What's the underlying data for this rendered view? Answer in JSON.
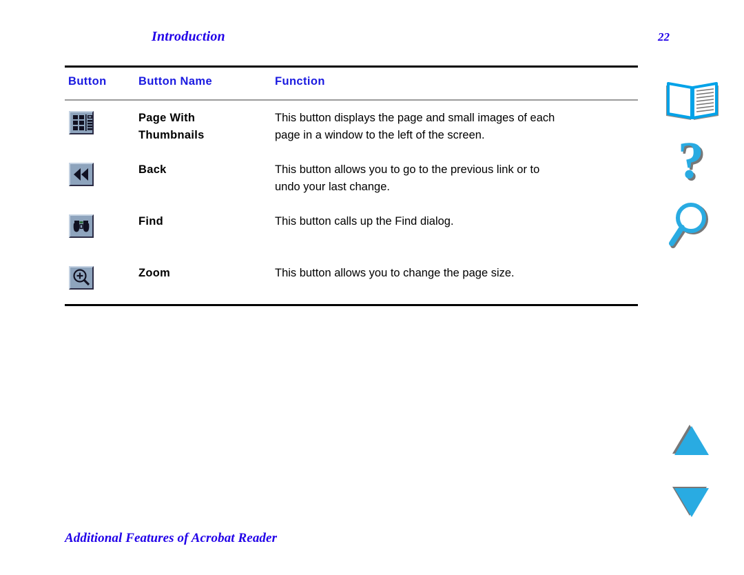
{
  "document": {
    "header_title": "Introduction",
    "page_number": "22",
    "footer_link": "Additional Features of Acrobat Reader"
  },
  "table": {
    "columns": {
      "button": "Button",
      "button_name": "Button Name",
      "function": "Function"
    },
    "rows": [
      {
        "icon": "page-with-thumbnails-icon",
        "name_line1": "Page With",
        "name_line2": "Thumbnails",
        "function_line1": "This button displays the page and small images of each",
        "function_line2": "page in a window to the left of the screen."
      },
      {
        "icon": "back-icon",
        "name_line1": "Back",
        "name_line2": "",
        "function_line1": "This button allows you to go to the previous link or to",
        "function_line2": "undo your last change."
      },
      {
        "icon": "find-binoculars-icon",
        "name_line1": "Find",
        "name_line2": "",
        "function_line1": "This button calls up the Find dialog.",
        "function_line2": ""
      },
      {
        "icon": "zoom-magnifier-icon",
        "name_line1": "Zoom",
        "name_line2": "",
        "function_line1": "This button allows you to change the page size.",
        "function_line2": ""
      }
    ]
  },
  "nav_icons": [
    {
      "name": "open-book-icon",
      "label": "Table of Contents"
    },
    {
      "name": "question-mark-icon",
      "label": "Help"
    },
    {
      "name": "magnifier-icon",
      "label": "Find"
    },
    {
      "name": "up-triangle-icon",
      "label": "Previous Page"
    },
    {
      "name": "down-triangle-icon",
      "label": "Next Page"
    }
  ],
  "colors": {
    "link_blue": "#2000e8",
    "header_blue": "#1a1ae0",
    "nav_cyan": "#29abe2",
    "nav_shadow": "#777777",
    "button_face": "#8ea4bd",
    "rule_black": "#000000",
    "rule_gray": "#9a9a9a"
  }
}
